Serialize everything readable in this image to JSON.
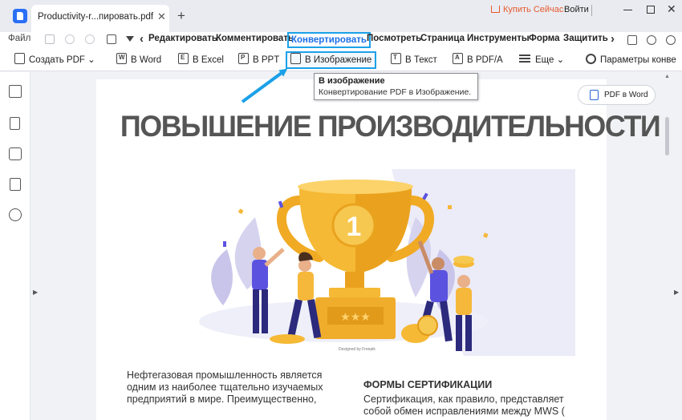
{
  "titlebar": {
    "tab_title": "Productivity-r...пировать.pdf",
    "tab_close": "✕",
    "tab_add": "+",
    "buy_label": "Купить Сейчас",
    "login_label": "Войти",
    "close_glyph": "✕"
  },
  "menubar": {
    "file_label": "Файл",
    "arrow_left": "‹",
    "arrow_right": "›",
    "items": [
      "Редактировать",
      "Комментировать",
      "Конвертировать",
      "Посмотреть",
      "Страница",
      "Инструменты",
      "Форма",
      "Защитить"
    ],
    "active_item": "Конвертировать"
  },
  "toolbar": {
    "create_pdf": "Создать PDF",
    "to_word": "В Word",
    "to_excel": "В Excel",
    "to_ppt": "В PPT",
    "to_image": "В Изображение",
    "to_text": "В Текст",
    "to_pdfa": "В PDF/A",
    "more": "Еще",
    "settings": "Параметры конве",
    "icons": {
      "word": "W",
      "excel": "E",
      "ppt": "P",
      "text": "T",
      "pdfa": "A"
    }
  },
  "tooltip": {
    "title": "В изображение",
    "description": "Конвертирование PDF в Изображение."
  },
  "floating": {
    "pdf_to_word": "PDF в Word"
  },
  "document": {
    "heading": "ПОВЫШЕНИЕ ПРОИЗВОДИТЕЛЬНОСТИ",
    "trophy_number": "1",
    "credit": "Designed by Freepik",
    "left_paragraph": "Нефтегазовая промышленность является одним из наиболее тщательно изучаемых предприятий в мире. Преимущественно,",
    "right_heading": "ФОРМЫ СЕРТИФИКАЦИИ",
    "right_paragraph_lines": [
      "Сертификация, как правило, представляет",
      "собой обмен исправлениями между MWS ("
    ]
  },
  "colors": {
    "accent": "#1ba1e8",
    "brand": "#2b6ff6",
    "buy": "#e65a2e",
    "trophy_gold": "#f2b632"
  },
  "icons": [
    "app-logo-icon",
    "cart-icon",
    "minimize-icon",
    "maximize-icon",
    "close-icon",
    "save-icon",
    "undo-icon",
    "redo-icon",
    "print-icon",
    "dropdown-icon",
    "send-icon",
    "upload-icon",
    "share-icon",
    "thumbnails-icon",
    "bookmark-icon",
    "comment-icon",
    "attachment-icon",
    "search-icon",
    "gear-icon"
  ]
}
